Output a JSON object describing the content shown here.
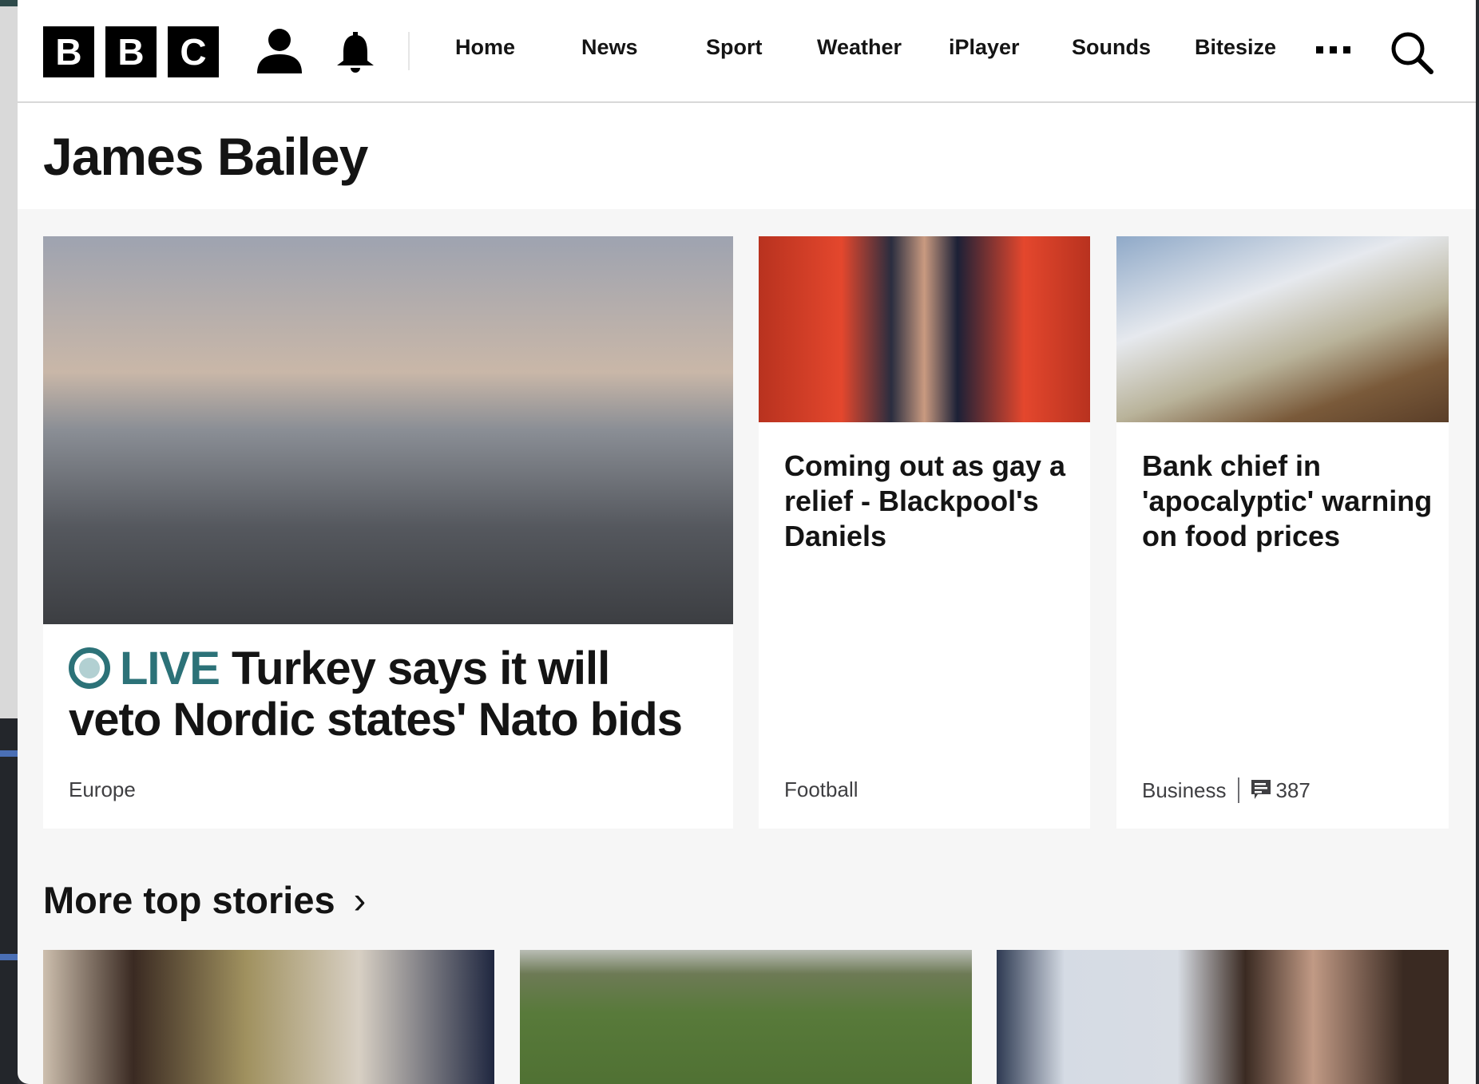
{
  "header": {
    "logo": "BBC",
    "logo_letters": [
      "B",
      "B",
      "C"
    ],
    "nav": [
      "Home",
      "News",
      "Sport",
      "Weather",
      "iPlayer",
      "Sounds",
      "Bitesize"
    ],
    "more_icon": "ellipsis-icon",
    "search_icon": "search-icon"
  },
  "page_title": "James Bailey",
  "stories": [
    {
      "live_label": "LIVE",
      "headline": "Turkey says it will veto Nordic states' Nato bids",
      "section": "Europe"
    },
    {
      "headline": "Coming out as gay a relief - Blackpool's Daniels",
      "section": "Football"
    },
    {
      "headline": "Bank chief in 'apocalyptic' warning on food prices",
      "section": "Business",
      "comments": "387"
    }
  ],
  "more_top_stories": {
    "label": "More top stories",
    "chevron": "›"
  },
  "colors": {
    "live": "#2c7278",
    "text": "#141414",
    "background": "#f6f6f6"
  }
}
